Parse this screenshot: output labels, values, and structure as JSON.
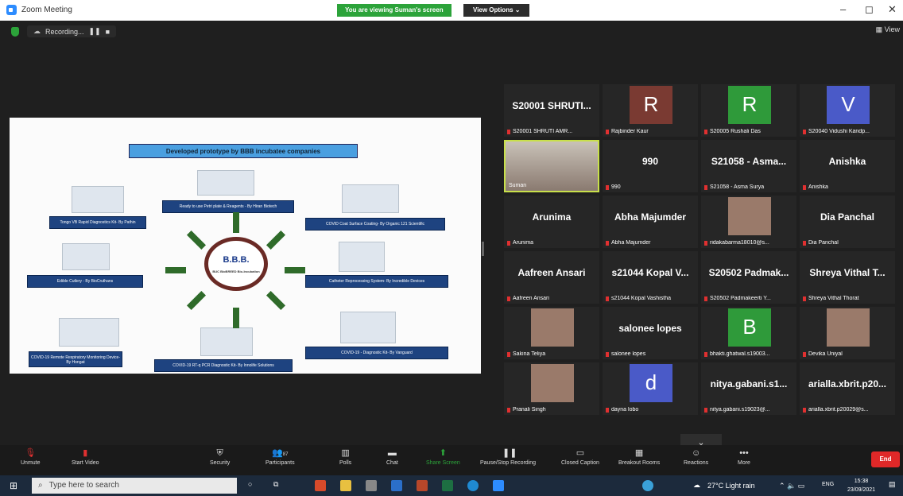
{
  "window": {
    "title": "Zoom Meeting",
    "view_banner": "You are viewing Suman's screen",
    "view_options": "View Options ⌄",
    "min": "–",
    "restore": "◻",
    "close": "✕"
  },
  "meeting": {
    "recording": "Recording...",
    "pause": "❚❚",
    "stop": "■",
    "view": "View"
  },
  "shared": {
    "heading": "Developed prototype by BBB incubatee companies",
    "hub": "B.B.B.",
    "hub_sub": "BUC BioBREED Bio-Incubation",
    "products": [
      "Tongo VB Rapid Diagnostics Kit- By Pathin",
      "Ready to use Petri plate & Reagents - By Hiran Biotech",
      "COVID Coat Surface Coating- By Organic 121 Scientific",
      "Edible Cutlery - By BioCruthans",
      "Catheter Reprocessing System- By Incredible Devices",
      "COVID-19 Remote Respiratory Monitoring Device- By Hongat",
      "COVID-19 RT-q PCR Diagnostic Kit- By Innolife Solutions",
      "COVID-19 - Diagnostic Kit- By Vanguard"
    ]
  },
  "participants": [
    {
      "name": "S20001 SHRUTI...",
      "label": "S20001 SHRUTI AMR..."
    },
    {
      "initial": "R",
      "label": "Rajbinder Kaur",
      "color": "#7a3a32"
    },
    {
      "initial": "R",
      "label": "S20005 Rushali Das",
      "color": "#2f9a3a"
    },
    {
      "initial": "V",
      "label": "S20040 Vidushi Kandp...",
      "color": "#4a5ac8"
    },
    {
      "label": "Suman",
      "video": true
    },
    {
      "name": "990",
      "label": "990"
    },
    {
      "name": "S21058 - Asma...",
      "label": "S21058 - Asma Surya"
    },
    {
      "name": "Anishka",
      "label": "Anishka"
    },
    {
      "name": "Arunima",
      "label": "Arunima"
    },
    {
      "name": "Abha Majumder",
      "label": "Abha Majumder"
    },
    {
      "label": "ridakabarma18010@s...",
      "photo": true
    },
    {
      "name": "Dia Panchal",
      "label": "Dia Panchal"
    },
    {
      "name": "Aafreen Ansari",
      "label": "Aafreen Ansari"
    },
    {
      "name": "s21044 Kopal V...",
      "label": "s21044 Kopal Vashistha"
    },
    {
      "name": "S20502 Padmak...",
      "label": "S20502 Padmakeerti Y..."
    },
    {
      "name": "Shreya Vithal T...",
      "label": "Shreya Vithal Thorat"
    },
    {
      "label": "Sakina Teliya",
      "photo": true
    },
    {
      "name": "salonee lopes",
      "label": "salonee lopes"
    },
    {
      "initial": "B",
      "label": "bhakti.ghatwal.s19003...",
      "color": "#2f9a3a"
    },
    {
      "label": "Devika Uniyal",
      "photo": true
    },
    {
      "label": "Pranali Singh",
      "photo": true
    },
    {
      "initial": "d",
      "label": "dayna lobo",
      "color": "#4a5ac8"
    },
    {
      "name": "nitya.gabani.s1...",
      "label": "nitya.gabani.s19023@..."
    },
    {
      "name": "arialla.xbrit.p20...",
      "label": "arialla.xbrit.p20029@s..."
    }
  ],
  "gallery_next": "⌄",
  "toolbar": {
    "unmute": "Unmute",
    "start_video": "Start Video",
    "security": "Security",
    "participants": "Participants",
    "participants_count": "87",
    "polls": "Polls",
    "chat": "Chat",
    "share_screen": "Share Screen",
    "pause_recording": "Pause/Stop Recording",
    "closed_caption": "Closed Caption",
    "breakout": "Breakout Rooms",
    "reactions": "Reactions",
    "more": "More",
    "end": "End"
  },
  "taskbar": {
    "search_placeholder": "Type here to search",
    "weather": "27°C  Light rain",
    "lang": "ENG",
    "time": "15:38",
    "date": "23/09/2021"
  }
}
